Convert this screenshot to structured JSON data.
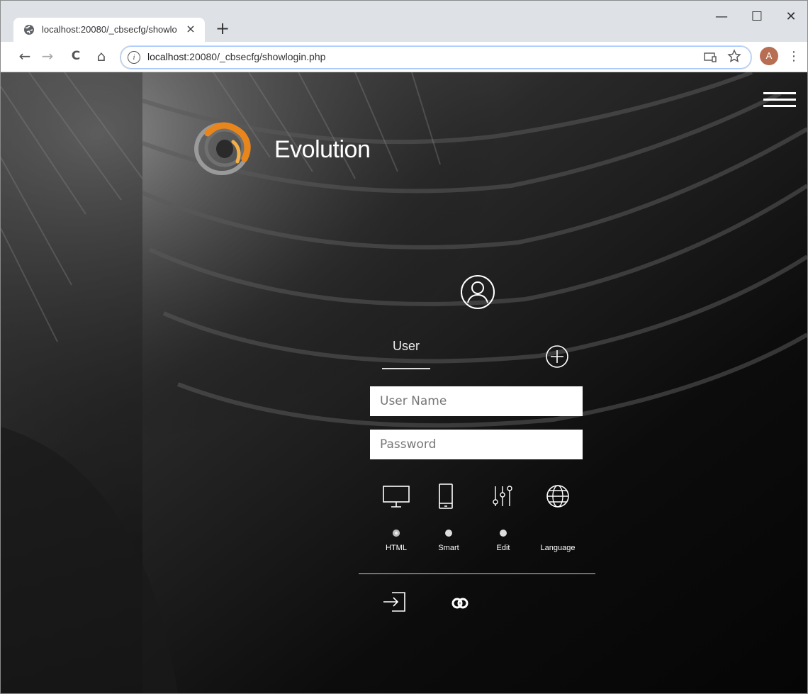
{
  "browser": {
    "tab_title": "localhost:20080/_cbsecfg/showlo",
    "tab_close": "×",
    "new_tab": "+",
    "window_controls": {
      "minimize": "—",
      "maximize": "☐",
      "close": "✕"
    },
    "nav": {
      "back": "←",
      "forward": "→",
      "reload": "C",
      "home": "⌂"
    },
    "url_host": "localhost",
    "url_rest": ":20080/_cbsecfg/showlogin.php",
    "profile_initial": "A",
    "menu": "⋮"
  },
  "page": {
    "brand_name": "Evolution",
    "user_tab_label": "User",
    "username_placeholder": "User Name",
    "password_placeholder": "Password",
    "options": [
      {
        "label": "HTML",
        "icon": "monitor-icon",
        "selected": true
      },
      {
        "label": "Smart",
        "icon": "smartphone-icon",
        "selected": false
      },
      {
        "label": "Edit",
        "icon": "sliders-icon",
        "selected": false
      },
      {
        "label": "Language",
        "icon": "globe-icon",
        "selected": false
      }
    ]
  },
  "colors": {
    "page_bg": "#080808",
    "logo_orange": "#e8861c",
    "profile_avatar": "#b76e53"
  }
}
